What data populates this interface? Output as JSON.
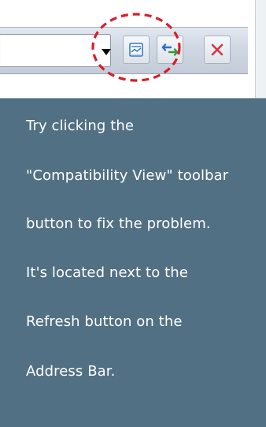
{
  "toolbar": {
    "address_bar": {
      "value": ""
    },
    "buttons": [
      {
        "name": "address-dropdown",
        "icon": "chevron-down-icon"
      },
      {
        "name": "compatibility-view",
        "icon": "compatibility-view-icon"
      },
      {
        "name": "refresh",
        "icon": "refresh-icon"
      },
      {
        "name": "stop",
        "icon": "close-icon"
      }
    ],
    "highlight": {
      "color": "#d81e2a",
      "style": "dashed-circle"
    }
  },
  "message": {
    "lines": [
      "Try clicking the",
      "\"Compatibility View\" toolbar",
      "button to fix the problem.",
      "It's located next to the",
      "Refresh button on the",
      "Address Bar."
    ],
    "background_color": "#527083",
    "text_color": "#ffffff"
  }
}
